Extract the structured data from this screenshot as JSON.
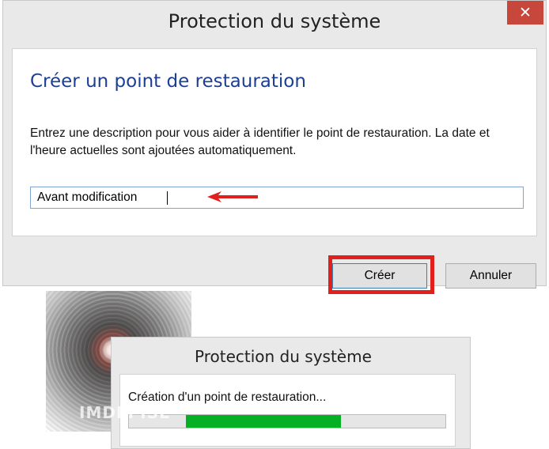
{
  "main_dialog": {
    "title": "Protection du système",
    "close_icon": "close-icon",
    "heading": "Créer un point de restauration",
    "description": "Entrez une description pour vous aider à identifier le point de restauration. La date et l'heure actuelles sont ajoutées automatiquement.",
    "input_value": "Avant modification",
    "create_label": "Créer",
    "cancel_label": "Annuler"
  },
  "progress_dialog": {
    "title": "Protection du système",
    "label": "Création d'un point de restauration...",
    "progress": {
      "start": 0.18,
      "end": 0.67
    }
  },
  "decoration": {
    "watermark": "IMDEPISE"
  },
  "colors": {
    "heading": "#1c3f95",
    "close_button": "#c7473c",
    "highlight": "#e0201c",
    "progress": "#06b025"
  }
}
